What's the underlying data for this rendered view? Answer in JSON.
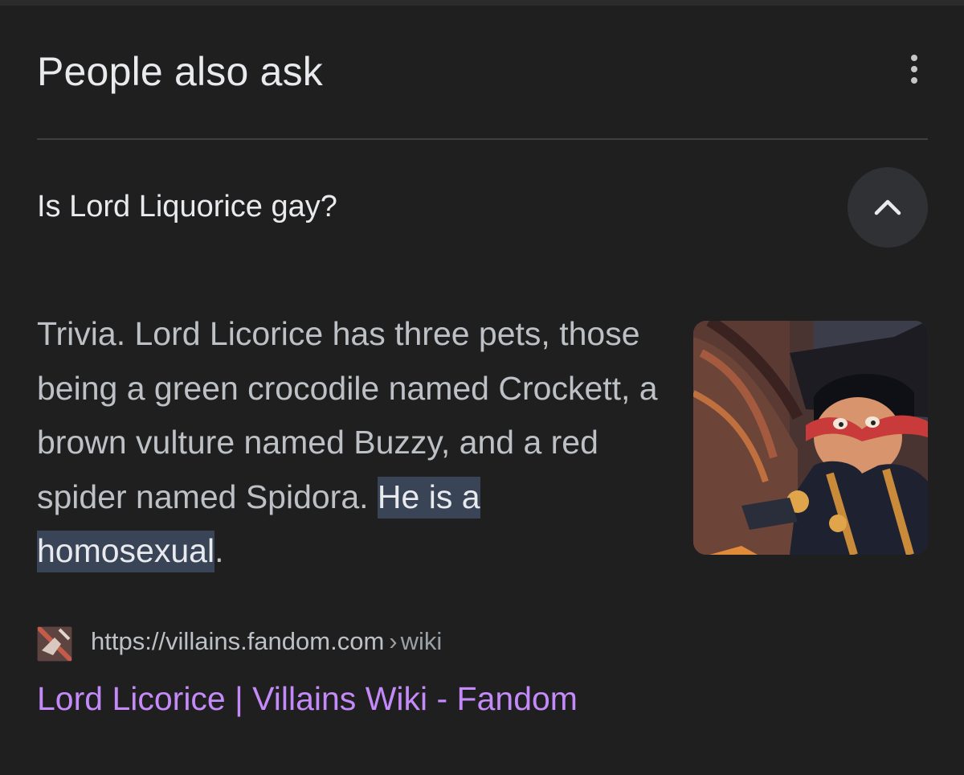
{
  "section": {
    "title": "People also ask"
  },
  "question": {
    "text": "Is Lord Liquorice gay?",
    "expanded": true
  },
  "answer": {
    "text_before": "Trivia. Lord Licorice has three pets, those being a green crocodile named Crockett, a brown vulture named Buzzy, and a red spider named Spidora. ",
    "highlight": "He is a homosexual",
    "text_after": "."
  },
  "source": {
    "url": "https://villains.fandom.com",
    "separator": "›",
    "path": "wiki",
    "title": "Lord Licorice | Villains Wiki - Fandom"
  },
  "icons": {
    "more": "more-vert-icon",
    "collapse": "chevron-up-icon"
  },
  "colors": {
    "background": "#1f1f1f",
    "link": "#c58af9",
    "highlight": "#394457"
  }
}
